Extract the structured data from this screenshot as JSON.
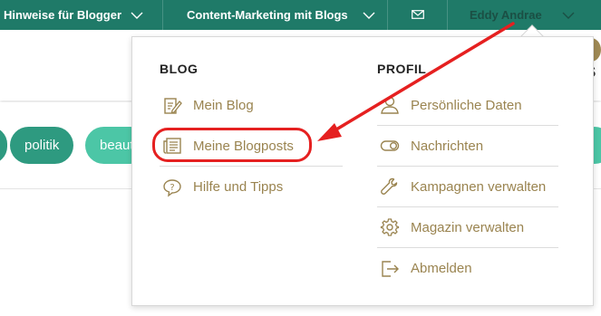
{
  "topbar": {
    "nav_blogger": "Hinweise für Blogger",
    "nav_content": "Content-Marketing mit Blogs",
    "user_name": "Eddy Andrae"
  },
  "tags": {
    "politik": "politik",
    "beauty": "beaut"
  },
  "side_glyph": "S",
  "menu": {
    "blog_title": "BLOG",
    "profil_title": "PROFIL",
    "blog_items": [
      {
        "label": "Mein Blog",
        "icon": "edit-icon"
      },
      {
        "label": "Meine Blogposts",
        "icon": "newspaper-icon"
      },
      {
        "label": "Hilfe und Tipps",
        "icon": "help-bubble-icon"
      }
    ],
    "profil_items": [
      {
        "label": "Persönliche Daten",
        "icon": "user-icon"
      },
      {
        "label": "Nachrichten",
        "icon": "toggle-icon"
      },
      {
        "label": "Kampagnen verwalten",
        "icon": "wrench-icon"
      },
      {
        "label": "Magazin verwalten",
        "icon": "gear-icon"
      },
      {
        "label": "Abmelden",
        "icon": "logout-icon"
      }
    ]
  },
  "colors": {
    "topbar": "#1f7a68",
    "menu_text": "#9a8450",
    "annotation": "#e52020",
    "tag_dark": "#2e9a80",
    "tag_light": "#4cc6a6"
  }
}
